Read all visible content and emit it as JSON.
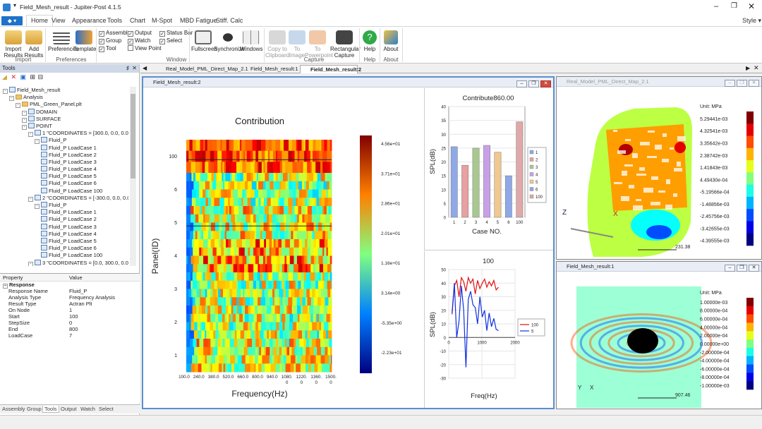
{
  "app": {
    "title": "Field_Mesh_result - Jupiter-Post 4.1.5",
    "style_label": "Style"
  },
  "ribbon": {
    "tabs": [
      "Home",
      "View",
      "Appearance",
      "Tools",
      "Chart",
      "M-Spot",
      "MBD Fatigue",
      "Stiff. Calc"
    ],
    "buttons": {
      "import": "Import Results",
      "add": "Add Results",
      "preferences": "Preferences",
      "template": "Template",
      "fullscreen": "Fullscreen",
      "synchronize": "Synchronize",
      "windows": "Windows",
      "copy": "Copy to Clipboard",
      "to_image": "To Image",
      "to_ppt": "To Powerpoint",
      "rect_capture": "Rectangular Capture",
      "help": "Help",
      "about": "About"
    },
    "checkboxes": {
      "assembly": "Assemble",
      "group": "Group",
      "tool": "Tool",
      "output": "Output",
      "watch": "Watch",
      "view_point": "View Point",
      "status_bar": "Status Bar",
      "select": "Select"
    },
    "groups": {
      "import": "Import",
      "preferences": "Preferences",
      "window": "Window",
      "capture": "Capture",
      "help": "Help",
      "about": "About"
    }
  },
  "tools": {
    "title": "Tools",
    "tree": [
      {
        "t": "Field_Mesh_result",
        "d": 0,
        "i": "db"
      },
      {
        "t": "Analysis",
        "d": 1,
        "i": "folder"
      },
      {
        "t": "PML_Green_Panel.plt",
        "d": 2,
        "i": "folder"
      },
      {
        "t": "DOMAIN",
        "d": 3,
        "i": "db"
      },
      {
        "t": "SURFACE",
        "d": 3,
        "i": "db"
      },
      {
        "t": "POINT",
        "d": 3,
        "i": "db"
      },
      {
        "t": "1 \"COORDINATES = [300.0, 0.0, 0.0]\"",
        "d": 4,
        "i": "db"
      },
      {
        "t": "Fluid_P",
        "d": 5,
        "i": "db"
      },
      {
        "t": "Fluid_P LoadCase 1",
        "d": 6,
        "i": "db"
      },
      {
        "t": "Fluid_P LoadCase 2",
        "d": 6,
        "i": "db"
      },
      {
        "t": "Fluid_P LoadCase 3",
        "d": 6,
        "i": "db"
      },
      {
        "t": "Fluid_P LoadCase 4",
        "d": 6,
        "i": "db"
      },
      {
        "t": "Fluid_P LoadCase 5",
        "d": 6,
        "i": "db"
      },
      {
        "t": "Fluid_P LoadCase 6",
        "d": 6,
        "i": "db"
      },
      {
        "t": "Fluid_P LoadCase 100",
        "d": 6,
        "i": "db"
      },
      {
        "t": "2 \"COORDINATES = [-300.0, 0.0, 0.0]\"",
        "d": 4,
        "i": "db"
      },
      {
        "t": "Fluid_P",
        "d": 5,
        "i": "db"
      },
      {
        "t": "Fluid_P LoadCase 1",
        "d": 6,
        "i": "db"
      },
      {
        "t": "Fluid_P LoadCase 2",
        "d": 6,
        "i": "db"
      },
      {
        "t": "Fluid_P LoadCase 3",
        "d": 6,
        "i": "db"
      },
      {
        "t": "Fluid_P LoadCase 4",
        "d": 6,
        "i": "db"
      },
      {
        "t": "Fluid_P LoadCase 5",
        "d": 6,
        "i": "db"
      },
      {
        "t": "Fluid_P LoadCase 6",
        "d": 6,
        "i": "db"
      },
      {
        "t": "Fluid_P LoadCase 100",
        "d": 6,
        "i": "db"
      },
      {
        "t": "3 \"COORDINATES = [0.0, 300.0, 0.0]\"",
        "d": 4,
        "i": "db"
      },
      {
        "t": "Fluid_P",
        "d": 5,
        "i": "db"
      }
    ]
  },
  "props": {
    "header": [
      "Property",
      "Value"
    ],
    "section": "Response",
    "rows": [
      [
        "Response Name",
        "Fluid_P"
      ],
      [
        "Analysis Type",
        "Frequency Analysis"
      ],
      [
        "Result Type",
        "Actran Plt"
      ],
      [
        "On Node",
        "1"
      ],
      [
        "Start",
        "100"
      ],
      [
        "StepSize",
        "0"
      ],
      [
        "End",
        "800"
      ],
      [
        "LoadCase",
        "7"
      ]
    ]
  },
  "bottom_tabs": [
    "Assembly",
    "Group",
    "Tools",
    "Output",
    "Watch",
    "Select"
  ],
  "doc_tabs": [
    "Real_Model_PML_Direct_Map_2.1",
    "Field_Mesh_result:1",
    "Field_Mesh_result:2"
  ],
  "windows": {
    "main": "Field_Mesh_result:2",
    "top_right": "Real_Model_PML_Direct_Map_2.1",
    "bottom_right": "Field_Mesh_result:1"
  },
  "colors": {
    "accent": "#1e72c8",
    "series_red": "#e01010",
    "series_blue": "#1030e0"
  },
  "chart_data": [
    {
      "type": "heatmap",
      "title": "Contribution",
      "xlabel": "Frequency(Hz)",
      "ylabel": "Panel(ID)",
      "x_ticks": [
        "100.0",
        "240.0",
        "380.0",
        "520.0",
        "660.0",
        "800.0",
        "940.0",
        "1080.\n0",
        "1220.\n0",
        "1360.\n0",
        "1500.\n0"
      ],
      "y_ticks": [
        "100",
        "6",
        "5",
        "4",
        "3",
        "2",
        "1"
      ],
      "colorbar_ticks": [
        "4.56e+01",
        "3.71e+01",
        "2.86e+01",
        "2.01e+01",
        "1.16e+01",
        "3.14e+00",
        "-5.35e+00",
        "-2.23e+01"
      ]
    },
    {
      "type": "bar",
      "title": "Contribute860.00",
      "xlabel": "Case NO.",
      "ylabel": "SPL(dB)",
      "ylim": [
        0,
        40
      ],
      "categories": [
        "1",
        "2",
        "3",
        "4",
        "5",
        "6",
        "100"
      ],
      "values": [
        25.5,
        18.8,
        25,
        26,
        23.5,
        15,
        34.5
      ],
      "legend": [
        "1",
        "2",
        "3",
        "4",
        "5",
        "6",
        "100"
      ],
      "bar_colors": [
        "#8fa8e8",
        "#e8a0a0",
        "#a8c890",
        "#c8a0e8",
        "#f0c890",
        "#8fa8e8",
        "#e0a8a8"
      ]
    },
    {
      "type": "line",
      "title": "100",
      "xlabel": "Freq(Hz)",
      "ylabel": "SPL(dB)",
      "ylim": [
        -30,
        50
      ],
      "xlim": [
        0,
        2000
      ],
      "series": [
        {
          "name": "100",
          "x": [
            100,
            170,
            240,
            310,
            380,
            450,
            520,
            590,
            660,
            730,
            800,
            870,
            940,
            1010,
            1080,
            1150,
            1220,
            1290,
            1360,
            1430,
            1500
          ],
          "values": [
            17,
            38,
            42,
            30,
            44,
            41,
            34,
            44,
            40,
            43,
            32,
            42,
            36,
            40,
            43,
            37,
            41,
            38,
            42,
            35,
            37
          ]
        },
        {
          "name": "5",
          "x": [
            100,
            170,
            240,
            310,
            380,
            450,
            520,
            590,
            660,
            730,
            800,
            870,
            940,
            1010,
            1080,
            1150,
            1220,
            1290,
            1360,
            1430,
            1500
          ],
          "values": [
            18,
            40,
            0,
            12,
            38,
            20,
            -22,
            28,
            34,
            24,
            22,
            10,
            30,
            15,
            20,
            5,
            18,
            8,
            14,
            6,
            5
          ]
        }
      ]
    }
  ],
  "contour_top": {
    "unit": "Unit: MPa",
    "ticks": [
      "5.29441e-03",
      "4.32541e-03",
      "3.35642e-03",
      "2.38742e-03",
      "1.41843e-03",
      "4.49430e-04",
      "-5.19566e-04",
      "-1.48856e-03",
      "-2.45756e-03",
      "-3.42655e-03",
      "-4.39555e-03"
    ],
    "scale": "231.38"
  },
  "contour_bottom": {
    "unit": "Unit: MPa",
    "ticks": [
      "1.00000e-03",
      "8.00000e-04",
      "6.00000e-04",
      "4.00000e-04",
      "2.00000e-04",
      "0.00000e+00",
      "-2.00000e-04",
      "-4.00000e-04",
      "-6.00000e-04",
      "-8.00000e-04",
      "-1.00000e-03"
    ],
    "scale": "907.46"
  }
}
